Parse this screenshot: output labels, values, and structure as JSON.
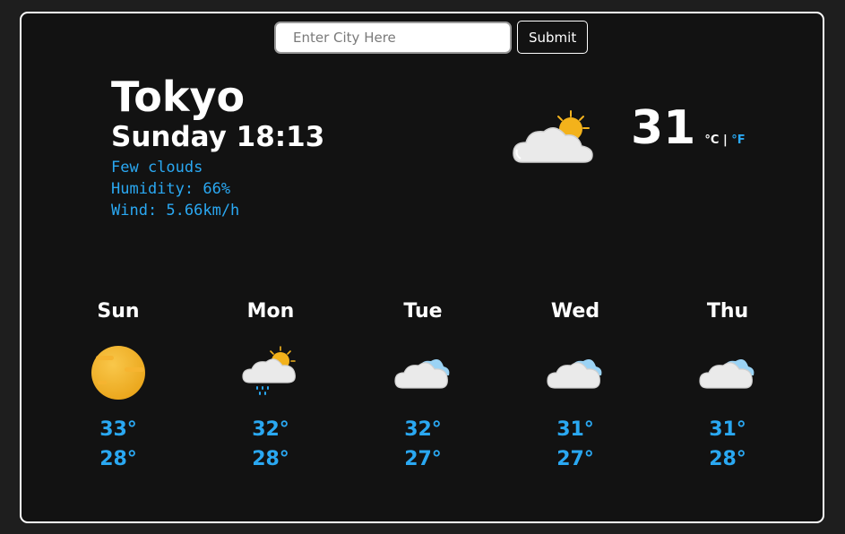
{
  "search": {
    "placeholder": "Enter City Here",
    "value": "",
    "submit_label": "Submit"
  },
  "current": {
    "city": "Tokyo",
    "datetime": "Sunday 18:13",
    "description": "Few clouds",
    "humidity": "Humidity: 66%",
    "wind": "Wind: 5.66km/h",
    "temperature": "31",
    "unit_c": "°C",
    "unit_sep": "|",
    "unit_f": "°F",
    "icon": "partly-cloudy-icon"
  },
  "forecast": [
    {
      "day": "Sun",
      "high": "33°",
      "low": "28°",
      "icon": "sun-icon"
    },
    {
      "day": "Mon",
      "high": "32°",
      "low": "28°",
      "icon": "sun-cloud-rain-icon"
    },
    {
      "day": "Tue",
      "high": "32°",
      "low": "27°",
      "icon": "cloud-icon"
    },
    {
      "day": "Wed",
      "high": "31°",
      "low": "27°",
      "icon": "cloud-icon"
    },
    {
      "day": "Thu",
      "high": "31°",
      "low": "28°",
      "icon": "cloud-icon"
    }
  ],
  "colors": {
    "background": "#121212",
    "accent": "#2aa8f2",
    "text": "#ffffff"
  }
}
